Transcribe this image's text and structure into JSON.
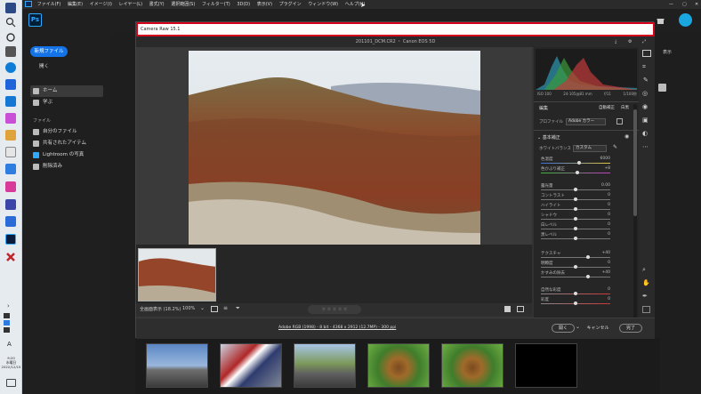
{
  "taskbar": {
    "time": "9:20",
    "weekday": "水曜日",
    "date": "2022/12/15",
    "lang": "A"
  },
  "menubar": {
    "items": [
      "ファイル(F)",
      "編集(E)",
      "イメージ(I)",
      "レイヤー(L)",
      "書式(Y)",
      "選択範囲(S)",
      "フィルター(T)",
      "3D(D)",
      "表示(V)",
      "プラグイン",
      "ウィンドウ(W)",
      "ヘルプ(H)"
    ]
  },
  "ps": {
    "logo": "Ps",
    "new_file": "新規ファイル",
    "open": "開く",
    "nav_home": "ホーム",
    "nav_learn": "学ぶ",
    "files_header": "ファイル",
    "nav_my_files": "自分のファイル",
    "nav_shared": "共有されたアイテム",
    "nav_lightroom": "Lightroom の写真",
    "nav_deleted": "削除済み",
    "right_edge_text": "表示"
  },
  "dialog": {
    "title": "Camera Raw 15.1",
    "filename": "201101_DCM.CR2 ・ Canon EOS 5D",
    "zoom_fit": "全画面表示 (18.2%)",
    "zoom_100": "100%",
    "stars": "☆ ☆ ☆ ☆ ☆",
    "footer_link": "Adobe RGB (1998) - 8 bit - 4368 x 2912 (12.7MP) - 300 ppi",
    "open_btn": "開く",
    "cancel_btn": "キャンセル",
    "done_btn": "完了"
  },
  "panel": {
    "exif": [
      "ISO 100",
      "24-105@81 mm",
      "f/11",
      "1/100秒"
    ],
    "edit_label": "編集",
    "auto_label": "自動補正",
    "bw_label": "白黒",
    "profile_label": "プロファイル",
    "profile_value": "Adobe カラー",
    "basic_label": "基本補正",
    "wb_label": "ホワイトバランス",
    "wb_value": "カスタム",
    "sliders": [
      {
        "label": "色温度",
        "value": "6000",
        "pos": 0.55
      },
      {
        "label": "色かぶり補正",
        "value": "+8",
        "pos": 0.53
      },
      {
        "label": "露光量",
        "value": "0.00",
        "pos": 0.5
      },
      {
        "label": "コントラスト",
        "value": "0",
        "pos": 0.5
      },
      {
        "label": "ハイライト",
        "value": "0",
        "pos": 0.5
      },
      {
        "label": "シャドウ",
        "value": "0",
        "pos": 0.5
      },
      {
        "label": "白レベル",
        "value": "0",
        "pos": 0.5
      },
      {
        "label": "黒レベル",
        "value": "0",
        "pos": 0.5
      },
      {
        "label": "テクスチャ",
        "value": "+40",
        "pos": 0.68
      },
      {
        "label": "明瞭度",
        "value": "0",
        "pos": 0.5
      },
      {
        "label": "かすみの除去",
        "value": "+40",
        "pos": 0.68
      },
      {
        "label": "自然な彩度",
        "value": "0",
        "pos": 0.5
      },
      {
        "label": "彩度",
        "value": "0",
        "pos": 0.5
      }
    ]
  },
  "colors": {
    "accent": "#1473e6",
    "red_highlight": "#d4001c",
    "panel_bg": "#262626"
  }
}
